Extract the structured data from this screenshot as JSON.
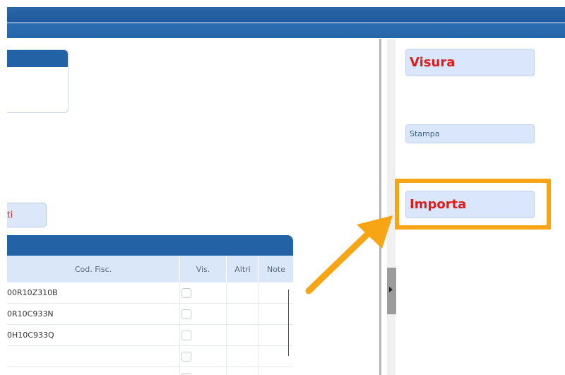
{
  "toolbar_left": {
    "partial_button_label": "ti"
  },
  "grid": {
    "columns": [
      "Cod. Fisc.",
      "Vis.",
      "Altri",
      "Note"
    ],
    "rows": [
      {
        "cod_fisc": "00R10Z310B"
      },
      {
        "cod_fisc": "0R10C933N"
      },
      {
        "cod_fisc": "0H10C933Q"
      },
      {
        "cod_fisc": ""
      },
      {
        "cod_fisc": ""
      }
    ]
  },
  "right_panel": {
    "visura_label": "Visura",
    "stampa_label": "Stampa",
    "importa_label": "Importa"
  },
  "colors": {
    "header_blue": "#2462a6",
    "highlight_orange": "#f7a515",
    "action_red": "#e11c1c",
    "button_bg": "#dae6fb"
  },
  "icons": {
    "splitter": "triangle-right-icon",
    "annotation": "arrow-icon"
  }
}
